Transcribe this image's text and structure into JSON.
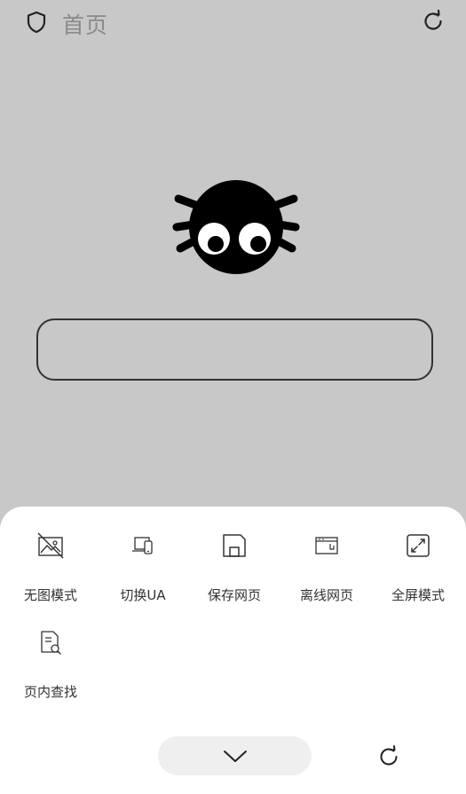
{
  "header": {
    "title": "首页",
    "left_icon": "shield-icon",
    "right_icon": "refresh-icon"
  },
  "main": {
    "logo_icon": "spider-icon",
    "search": {
      "value": "",
      "placeholder": ""
    }
  },
  "menu": {
    "items": [
      {
        "label": "无图模式",
        "icon": "no-image-icon"
      },
      {
        "label": "切换UA",
        "icon": "devices-icon"
      },
      {
        "label": "保存网页",
        "icon": "save-icon"
      },
      {
        "label": "离线网页",
        "icon": "offline-page-icon"
      },
      {
        "label": "全屏模式",
        "icon": "fullscreen-icon"
      },
      {
        "label": "页内查找",
        "icon": "find-in-page-icon"
      }
    ],
    "collapse_icon": "chevron-down-icon",
    "refresh_icon": "refresh-icon"
  },
  "colors": {
    "background": "#c8c8c9",
    "sheet": "#ffffff",
    "title_text": "#8a8a8a",
    "icon_stroke": "#333333"
  }
}
